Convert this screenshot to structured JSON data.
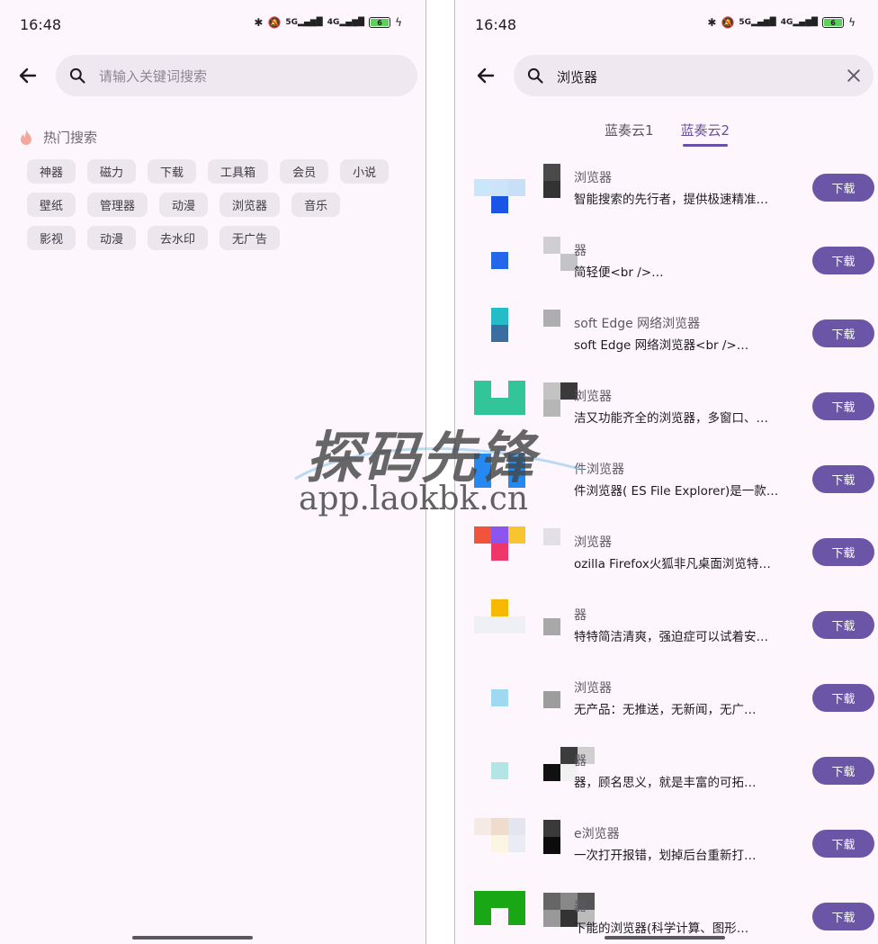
{
  "left": {
    "status": {
      "time": "16:48",
      "battery": "6"
    },
    "search": {
      "placeholder": "请输入关键词搜索"
    },
    "hot": {
      "title": "热门搜索",
      "tags": [
        "神器",
        "磁力",
        "下载",
        "工具箱",
        "会员",
        "小说",
        "壁纸",
        "管理器",
        "动漫",
        "浏览器",
        "音乐",
        "影视",
        "动漫",
        "去水印",
        "无广告"
      ]
    }
  },
  "right": {
    "status": {
      "time": "16:48",
      "battery": "6"
    },
    "search": {
      "value": "浏览器"
    },
    "tabs": [
      {
        "label": "蓝奏云1"
      },
      {
        "label": "蓝奏云2"
      }
    ],
    "download_label": "下载",
    "results": [
      {
        "name": "浏览器",
        "desc": "智能搜索的先行者，提供极速精准…"
      },
      {
        "name": "器",
        "desc": "简轻便<br />…"
      },
      {
        "name": "soft Edge 网络浏览器",
        "desc": "soft Edge 网络浏览器<br />…"
      },
      {
        "name": "浏览器",
        "desc": "洁又功能齐全的浏览器，多窗口、…"
      },
      {
        "name": "件浏览器",
        "desc": "件浏览器( ES File Explorer)是一款…"
      },
      {
        "name": "浏览器",
        "desc": "ozilla Firefox火狐非凡桌面浏览特…"
      },
      {
        "name": "器",
        "desc": "特特简洁清爽，强迫症可以试着安…"
      },
      {
        "name": "浏览器",
        "desc": "无产品：无推送，无新闻，无广…"
      },
      {
        "name": "器",
        "desc": "器，顾名思义，就是丰富的可拓…"
      },
      {
        "name": "e浏览器",
        "desc": "一次打开报错，划掉后台重新打…"
      },
      {
        "name": "器",
        "desc": "下能的浏览器(科学计算、图形…"
      }
    ]
  },
  "watermark": {
    "title": "探码先锋",
    "url": "app.laokbk.cn"
  }
}
